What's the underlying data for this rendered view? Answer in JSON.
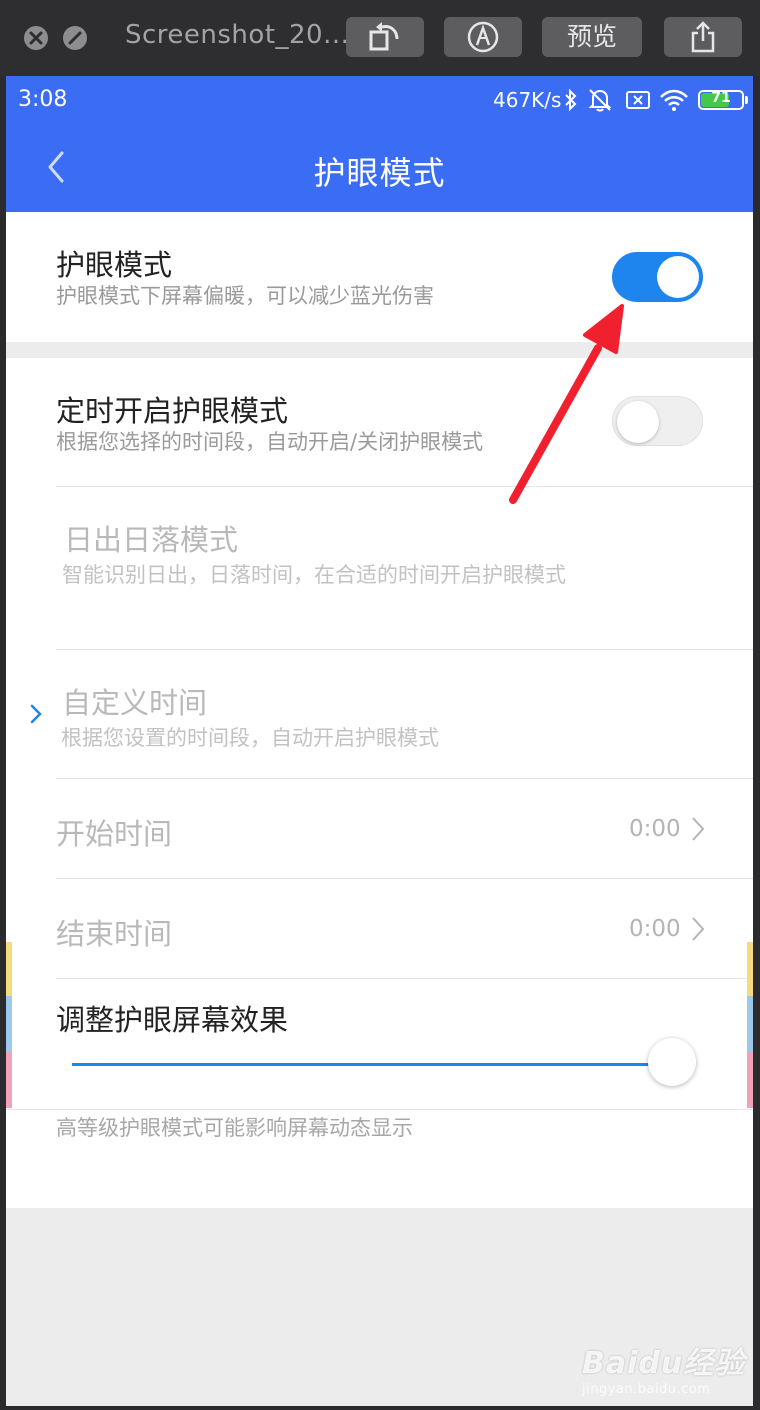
{
  "window": {
    "title": "Screenshot_20...",
    "preview_label": "预览"
  },
  "status_bar": {
    "time": "3:08",
    "speed": "467K/s",
    "battery": "71",
    "battery_level": 0.71,
    "icons": [
      "bluetooth-icon",
      "mute-bell-icon",
      "sim-off-icon",
      "wifi-icon",
      "battery-icon"
    ]
  },
  "header": {
    "title": "护眼模式",
    "back_icon": "chevron-left-icon"
  },
  "eye_mode": {
    "title": "护眼模式",
    "subtitle": "护眼模式下屏幕偏暖，可以减少蓝光伤害",
    "enabled": true
  },
  "schedule": {
    "title": "定时开启护眼模式",
    "subtitle": "根据您选择的时间段，自动开启/关闭护眼模式",
    "enabled": false
  },
  "sunrise": {
    "title": "日出日落模式",
    "subtitle": "智能识别日出，日落时间，在合适的时间开启护眼模式"
  },
  "custom_time": {
    "title": "自定义时间",
    "subtitle": "根据您设置的时间段，自动开启护眼模式"
  },
  "start_time": {
    "label": "开始时间",
    "value": "0:00"
  },
  "end_time": {
    "label": "结束时间",
    "value": "0:00"
  },
  "effect": {
    "title": "调整护眼屏幕效果",
    "level": 1.0
  },
  "note": "高等级护眼模式可能影响屏幕动态显示",
  "colors": {
    "primary": "#3a6df3",
    "switch_on": "#1f85ee",
    "annotation_arrow": "#f0202e"
  },
  "watermark": {
    "brand": "Baidu经验",
    "url": "jingyan.baidu.com"
  }
}
